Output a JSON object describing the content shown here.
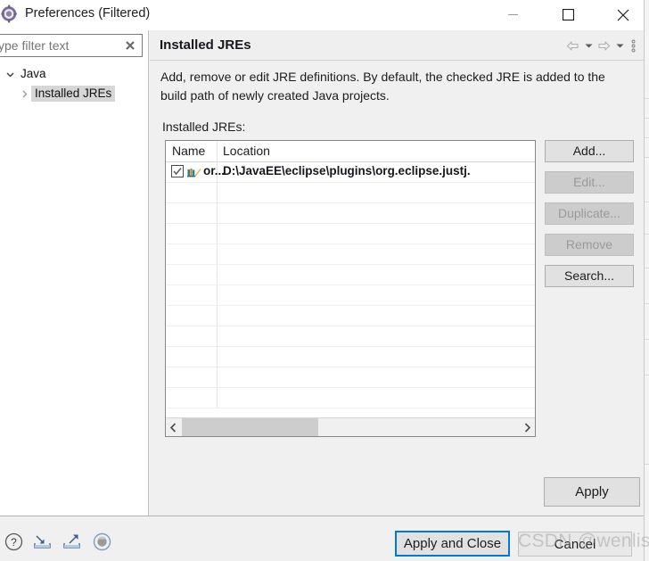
{
  "window": {
    "title": "Preferences (Filtered)",
    "icon": "preferences-gear-icon",
    "minimize_label": "Minimize",
    "maximize_label": "Maximize",
    "close_label": "Close"
  },
  "filter": {
    "value": "",
    "placeholder": "ype filter text",
    "clear_icon": "clear-x-icon"
  },
  "tree": {
    "items": [
      {
        "label": "Java",
        "level": 0,
        "expanded": true,
        "selected": false,
        "arrow": "chevron-down-icon"
      },
      {
        "label": "Installed JREs",
        "level": 1,
        "expanded": false,
        "selected": true,
        "arrow": "chevron-right-icon"
      }
    ]
  },
  "content": {
    "title": "Installed JREs",
    "description": "Add, remove or edit JRE definitions. By default, the checked JRE is added to the build path of newly created Java projects.",
    "list_label": "Installed JREs:",
    "tools": [
      {
        "name": "back-arrow-icon",
        "label": "Back"
      },
      {
        "name": "back-dropdown-icon",
        "label": "Back history"
      },
      {
        "name": "forward-arrow-icon",
        "label": "Forward"
      },
      {
        "name": "forward-dropdown-icon",
        "label": "Forward history"
      },
      {
        "name": "more-menu-icon",
        "label": "View Menu"
      }
    ]
  },
  "table": {
    "columns": [
      "Name",
      "Location"
    ],
    "rows": [
      {
        "checked": true,
        "icon": "jre-library-icon",
        "name": "or...",
        "location": "D:\\JavaEE\\eclipse\\plugins\\org.eclipse.justj."
      }
    ],
    "empty_row_count": 11,
    "scrollbar": {
      "left_arrow": "chevron-left-icon",
      "right_arrow": "chevron-right-icon",
      "thumb_percent": 37
    }
  },
  "side_buttons": [
    {
      "label": "Add...",
      "enabled": true
    },
    {
      "label": "Edit...",
      "enabled": false
    },
    {
      "label": "Duplicate...",
      "enabled": false
    },
    {
      "label": "Remove",
      "enabled": false
    },
    {
      "label": "Search...",
      "enabled": true
    }
  ],
  "apply_button": {
    "label": "Apply"
  },
  "footer": {
    "icons": [
      {
        "name": "help-icon",
        "label": "Help"
      },
      {
        "name": "import-icon",
        "label": "Import preferences"
      },
      {
        "name": "export-icon",
        "label": "Export preferences"
      },
      {
        "name": "restore-defaults-icon",
        "label": "Restore Defaults"
      }
    ],
    "apply_and_close": "Apply and Close",
    "cancel": "Cancel"
  },
  "watermark": "CSDN @wenlish",
  "colors": {
    "dialog_bg": "#f0f0f0",
    "panel_bg": "#ffffff",
    "focus_border": "#0078d7",
    "button_face": "#e1e1e1",
    "button_disabled": "#cccccc",
    "selection": "#d6d6d6"
  }
}
